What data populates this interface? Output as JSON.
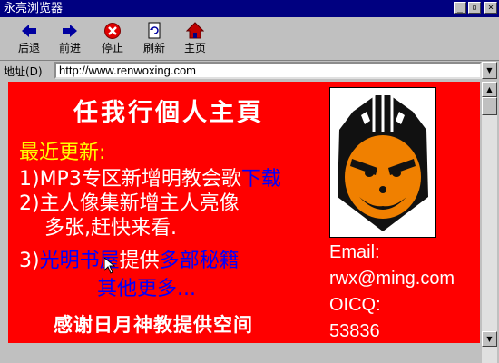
{
  "window": {
    "title": "永亮浏览器",
    "controls": {
      "minimize": "_",
      "maximize": "▫",
      "close": "×"
    }
  },
  "toolbar": {
    "back_label": "后退",
    "forward_label": "前进",
    "stop_label": "停止",
    "refresh_label": "刷新",
    "home_label": "主页"
  },
  "address": {
    "label": "地址(D)",
    "url": "http://www.renwoxing.com"
  },
  "page": {
    "heading": "任我行個人主頁",
    "recent_title": "最近更新:",
    "item1_prefix": "1)MP3专区新增明教会歌",
    "item1_link": "下载",
    "item2_line1": "2)主人像集新增主人亮像",
    "item2_line2": "多张,赶快来看.",
    "item3_prefix": "3)",
    "item3_link1": "光明书屋",
    "item3_mid": "提供",
    "item3_link2": "多部秘籍",
    "more": "其他更多...",
    "thanks": "感谢日月神教提供空间",
    "email_label": "Email:",
    "email": "rwx@ming.com",
    "oicq_label": "OICQ:",
    "oicq": "53836"
  },
  "colors": {
    "page_bg": "#ff0000",
    "link": "#0000ff",
    "heading_yellow": "#ffff00",
    "titlebar": "#000080"
  }
}
